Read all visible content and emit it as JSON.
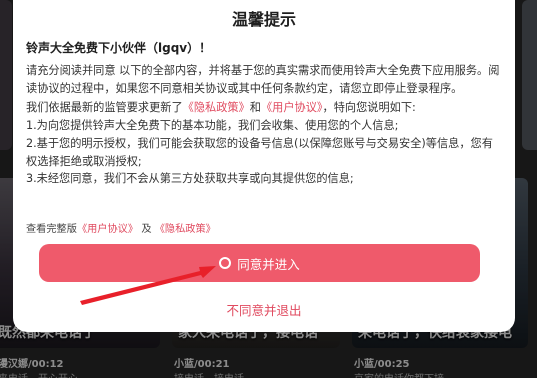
{
  "background": {
    "thumbs": [
      {
        "caption": "既然都来电话了",
        "author": "漫汉娜/00:12",
        "sub": "来电话，开心开心"
      },
      {
        "caption": "家人来电话了，接电话",
        "author": "小蓝/00:21",
        "sub": "接电话，接电话"
      },
      {
        "caption": "来电话了，快给哀家接电",
        "author": "小蓝/00:25",
        "sub": "哀家的电话你都下接"
      }
    ]
  },
  "dialog": {
    "title": "温馨提示",
    "greeting": "铃声大全免费下小伙伴（lgqv）！",
    "para1": "请充分阅读并同意 以下的全部内容，并将基于您的真实需求而使用铃声大全免费下应用服务。阅读协议的过程中，如果您不同意相关协议或其中任何条款约定，请您立即停止登录程序。",
    "para2_prefix": "我们依据最新的监管要求更新了",
    "privacy_link": "《隐私政策》",
    "and": "和",
    "user_link": "《用户协议》",
    "para2_suffix": "，特向您说明如下:",
    "item1": "1.为向您提供铃声大全免费下的基本功能，我们会收集、使用您的个人信息;",
    "item2": "2.基于您的明示授权，我们可能会获取您的设备号信息(以保障您账号与交易安全)等信息，您有权选择拒绝或取消授权;",
    "item3": "3.未经您同意，我们不会从第三方处获取共享或向其提供您的信息;",
    "view_full": "查看完整版",
    "view_and": "及",
    "agree_button": "同意并进入",
    "decline_button": "不同意并退出"
  },
  "colors": {
    "accent": "#ef5a6b",
    "link": "#e04a5f"
  }
}
